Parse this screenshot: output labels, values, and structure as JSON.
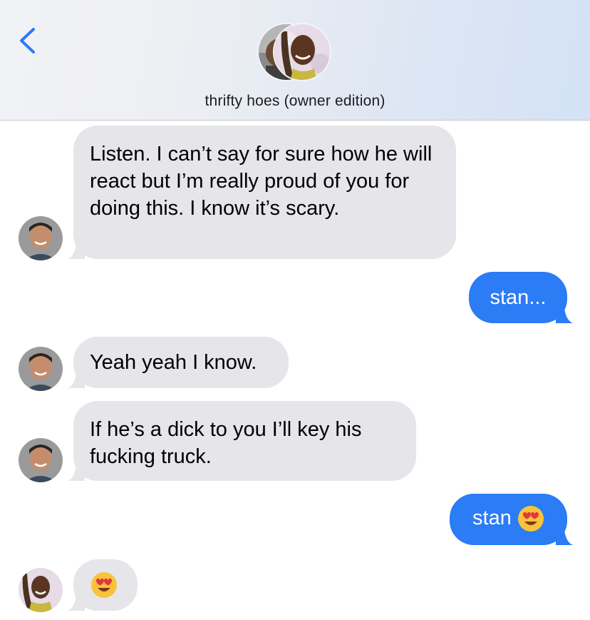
{
  "header": {
    "back_icon": "chevron-left-icon",
    "group_name": "thrifty hoes (owner edition)"
  },
  "colors": {
    "accent": "#2b7cf5",
    "incoming_bubble": "#e5e5ea",
    "header_bg": "#eef0f5"
  },
  "messages": [
    {
      "direction": "incoming",
      "sender_avatar": "man-avatar",
      "text": "Listen. I can’t say for sure how he will react but I’m really proud of you for doing this. I know it’s scary."
    },
    {
      "direction": "outgoing",
      "text": "stan..."
    },
    {
      "direction": "incoming",
      "sender_avatar": "man-avatar",
      "text": "Yeah yeah I know."
    },
    {
      "direction": "incoming",
      "sender_avatar": "man-avatar",
      "text": "If he’s a dick to you I’ll key his fucking truck."
    },
    {
      "direction": "outgoing",
      "text": "stan",
      "emoji": "heart-eyes-emoji"
    },
    {
      "direction": "incoming",
      "sender_avatar": "woman-avatar",
      "emoji": "heart-eyes-emoji"
    }
  ]
}
